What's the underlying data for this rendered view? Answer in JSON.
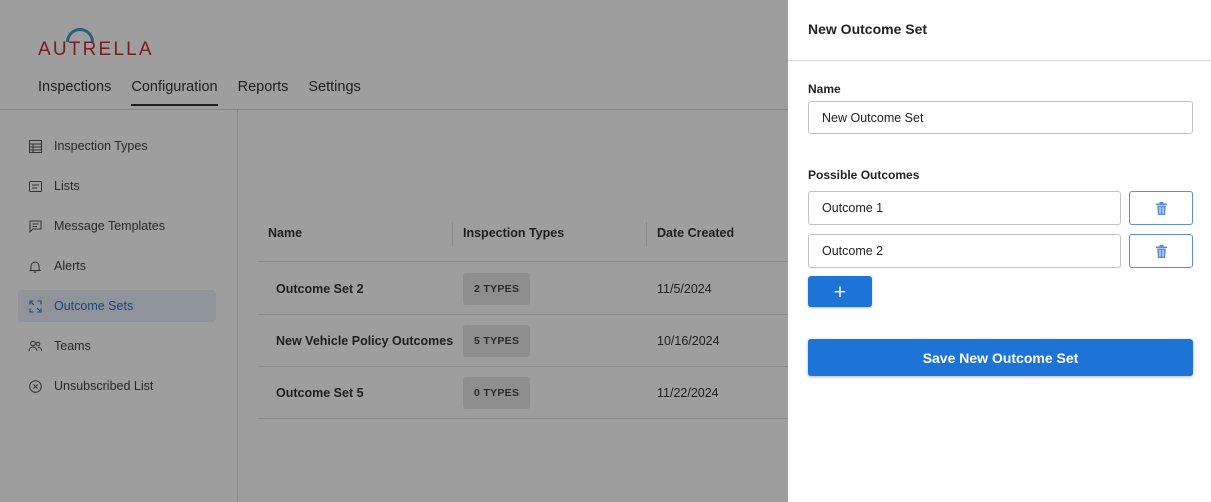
{
  "brand": {
    "logo_text": "AUTRELLA",
    "logo_color": "#c0303a",
    "logo_arc_color": "#3aa0c8"
  },
  "topnav": {
    "tabs": [
      {
        "label": "Inspections"
      },
      {
        "label": "Configuration",
        "active": true
      },
      {
        "label": "Reports"
      },
      {
        "label": "Settings"
      }
    ]
  },
  "sidebar": {
    "items": [
      {
        "label": "Inspection Types",
        "icon": "table-icon"
      },
      {
        "label": "Lists",
        "icon": "list-icon"
      },
      {
        "label": "Message Templates",
        "icon": "message-icon"
      },
      {
        "label": "Alerts",
        "icon": "bell-icon"
      },
      {
        "label": "Outcome Sets",
        "icon": "expand-icon",
        "active": true
      },
      {
        "label": "Teams",
        "icon": "team-icon"
      },
      {
        "label": "Unsubscribed List",
        "icon": "circle-x-icon"
      }
    ]
  },
  "table": {
    "columns": [
      "Name",
      "Inspection Types",
      "Date Created"
    ],
    "rows": [
      {
        "name": "Outcome Set 2",
        "types": "2 TYPES",
        "date": "11/5/2024"
      },
      {
        "name": "New Vehicle Policy Outcomes",
        "types": "5 TYPES",
        "date": "10/16/2024"
      },
      {
        "name": "Outcome Set 5",
        "types": "0 TYPES",
        "date": "11/22/2024"
      }
    ]
  },
  "drawer": {
    "title": "New Outcome Set",
    "name_label": "Name",
    "name_value": "New Outcome Set",
    "outcomes_label": "Possible Outcomes",
    "outcomes": [
      {
        "value": "Outcome 1"
      },
      {
        "value": "Outcome 2"
      }
    ],
    "add_label": "+",
    "save_label": "Save New Outcome Set",
    "accent_color": "#1e74d6"
  }
}
